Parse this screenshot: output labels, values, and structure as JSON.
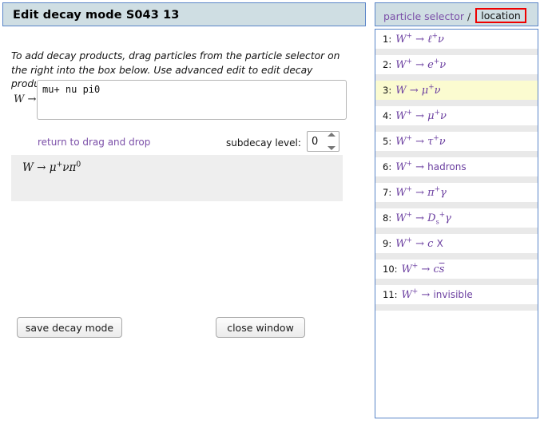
{
  "edit_panel": {
    "title": "Edit decay mode S043 13",
    "instructions": "To add decay products, drag particles from the particle selector on the right into the box below. Use advanced edit to edit decay products.",
    "parent_particle_label": "W →",
    "textarea_value": "mu+ nu pi0",
    "textarea_placeholder": "",
    "return_link_label": "return to drag and drop",
    "subdecay_label": "subdecay level:",
    "subdecay_value": "0",
    "spinner_up_icon": "chevron-up-icon",
    "spinner_down_icon": "chevron-down-icon",
    "preview_formula": "W → μ⁺νπ⁰",
    "save_button": "save decay mode",
    "close_button": "close window"
  },
  "selector_panel": {
    "breadcrumb_root": "particle selector",
    "breadcrumb_separator": "/",
    "breadcrumb_current": "location",
    "highlight_color": "#ee0000",
    "selected_row_color": "#fbfbd0",
    "link_color": "#7b4fa8",
    "items": [
      {
        "index": "1:",
        "formula": "W⁺ → ℓ⁺ν",
        "selected": false
      },
      {
        "index": "2:",
        "formula": "W⁺ → e⁺ν",
        "selected": false
      },
      {
        "index": "3:",
        "formula": "W → μ⁺ν",
        "selected": true
      },
      {
        "index": "4:",
        "formula": "W⁺ → μ⁺ν",
        "selected": false
      },
      {
        "index": "5:",
        "formula": "W⁺ → τ⁺ν",
        "selected": false
      },
      {
        "index": "6:",
        "formula": "W⁺ → hadrons",
        "selected": false
      },
      {
        "index": "7:",
        "formula": "W⁺ → π⁺γ",
        "selected": false
      },
      {
        "index": "8:",
        "formula": "W⁺ → Dₛ⁺ γ",
        "selected": false
      },
      {
        "index": "9:",
        "formula": "W⁺ → c X",
        "selected": false
      },
      {
        "index": "10:",
        "formula": "W⁺ → c s̄",
        "selected": false
      },
      {
        "index": "11:",
        "formula": "W⁺ → invisible",
        "selected": false
      }
    ]
  }
}
